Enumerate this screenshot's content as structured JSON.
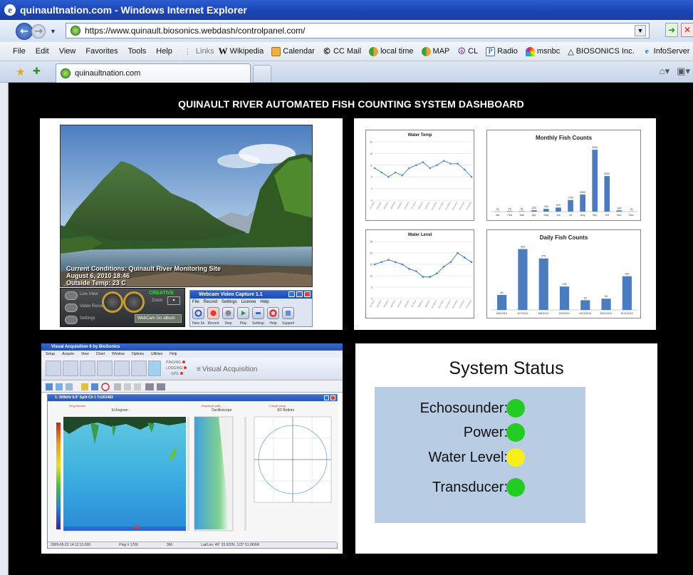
{
  "window": {
    "title": "quinaultnation.com - Windows Internet Explorer"
  },
  "address_bar": {
    "url": "https://www.quinault.biosonics.webdash/controlpanel.com/"
  },
  "menu": {
    "items": [
      "File",
      "Edit",
      "View",
      "Favorites",
      "Tools",
      "Help"
    ],
    "links_label": "Links",
    "links": [
      {
        "label": "Wikipedia",
        "icon": "wikipedia-icon",
        "color": "#222222"
      },
      {
        "label": "Calendar",
        "icon": "calendar-icon",
        "color": "#e8a13a"
      },
      {
        "label": "CC Mail",
        "icon": "cc-mail-icon",
        "color": "#333333"
      },
      {
        "label": "local time",
        "icon": "people-icon",
        "color": "#3aa03a"
      },
      {
        "label": "MAP",
        "icon": "people-icon",
        "color": "#3aa03a"
      },
      {
        "label": "CL",
        "icon": "peace-icon",
        "color": "#6a2aa8"
      },
      {
        "label": "Radio",
        "icon": "p-icon",
        "color": "#4a6ab0"
      },
      {
        "label": "msnbc",
        "icon": "peacock-icon",
        "color": "#d04a2a"
      },
      {
        "label": "BIOSONICS Inc.",
        "icon": "biosonics-icon",
        "color": "#333333"
      },
      {
        "label": "InfoServer",
        "icon": "ie-icon",
        "color": "#2a6ad0"
      }
    ]
  },
  "tab": {
    "label": "quinaultnation.com"
  },
  "dashboard": {
    "title": "QUINAULT RIVER AUTOMATED FISH COUNTING SYSTEM DASHBOARD",
    "webcam": {
      "caption_line1": "Current Conditions: Quinault River Monitoring Site",
      "caption_line2": "August 6, 2010 18:46",
      "caption_line3": "Outside Temp: 23 C",
      "brand": "CREATIVE",
      "album_label": "WebCam Go album",
      "btn_labels": [
        "Live View",
        "Video Recording",
        "Settings"
      ],
      "zoom_label": "Zoom",
      "app_title": "Webcam Video Capture 1.1",
      "app_menu": [
        "File",
        "Record",
        "Settings",
        "License",
        "Help"
      ],
      "app_buttons": [
        "New Session",
        "Record",
        "Stop",
        "Play",
        "Settings",
        "Help",
        "Support"
      ]
    },
    "charts": {
      "water_temp": {
        "type": "line",
        "title": "Water Temp",
        "values": [
          11,
          9.5,
          8,
          9.5,
          8.5,
          11,
          12,
          13,
          11,
          12,
          13.5,
          12.5,
          12.5,
          10.5,
          8
        ],
        "ylim": [
          0,
          20
        ],
        "color": "#5b8ac6"
      },
      "monthly_counts": {
        "type": "bar",
        "title": "Monthly Fish Counts",
        "categories": [
          "Jan",
          "Feb",
          "Mar",
          "Apr",
          "May",
          "Jun",
          "Jul",
          "Aug",
          "Sep",
          "Oct",
          "Nov",
          "Dec"
        ],
        "values": [
          25,
          75,
          62,
          200,
          400,
          600,
          1700,
          2500,
          9050,
          5200,
          180,
          25
        ],
        "ylim": [
          0,
          10000
        ],
        "color": "#4a7cbf"
      },
      "water_level": {
        "type": "line",
        "title": "Water Level",
        "values": [
          15,
          16,
          17,
          16,
          15,
          13,
          12,
          9.5,
          9.5,
          11,
          14,
          16,
          20,
          18,
          16
        ],
        "ylim": [
          0,
          25
        ],
        "color": "#4a7cbf"
      },
      "daily_counts": {
        "type": "bar",
        "title": "Daily Fish Counts",
        "categories": [
          "8/6/2010",
          "8/7/2010",
          "8/8/2010",
          "8/9/2010",
          "8/10/2010",
          "8/11/2010",
          "8/12/2010"
        ],
        "values": [
          80,
          325,
          275,
          125,
          52,
          60,
          180
        ],
        "ylim": [
          0,
          350
        ],
        "color": "#4a7cbf"
      }
    },
    "sonar": {
      "app_title": "Visual Acquisition 6 by BioSonics",
      "menu": [
        "Setup",
        "Acquire",
        "View",
        "Chart",
        "Window",
        "Options",
        "Utilities",
        "Help"
      ],
      "logo_text": "Visual Acquisition",
      "status_labels": [
        "PINGING",
        "LOGGING",
        "GPS"
      ],
      "window_title": "1: 200kHz 6.5° Split Ch 1 Tx201483",
      "panel_labels": [
        "Echogram",
        "Oscilloscope",
        "SD Bottom"
      ],
      "status_bar": [
        "2009-05-22 14:12:13.000",
        "Ping # 1706",
        "366",
        "Lat/Lon: 46° 33.922N, 123° 51.869W"
      ]
    },
    "system_status": {
      "title": "System Status",
      "items": [
        {
          "label": "Echosounder:",
          "state": "#22cc22"
        },
        {
          "label": "Power:",
          "state": "#22cc22"
        },
        {
          "label": "Water Level:",
          "state": "#f7ee1a"
        },
        {
          "label": "Transducer:",
          "state": "#22cc22"
        }
      ]
    }
  }
}
